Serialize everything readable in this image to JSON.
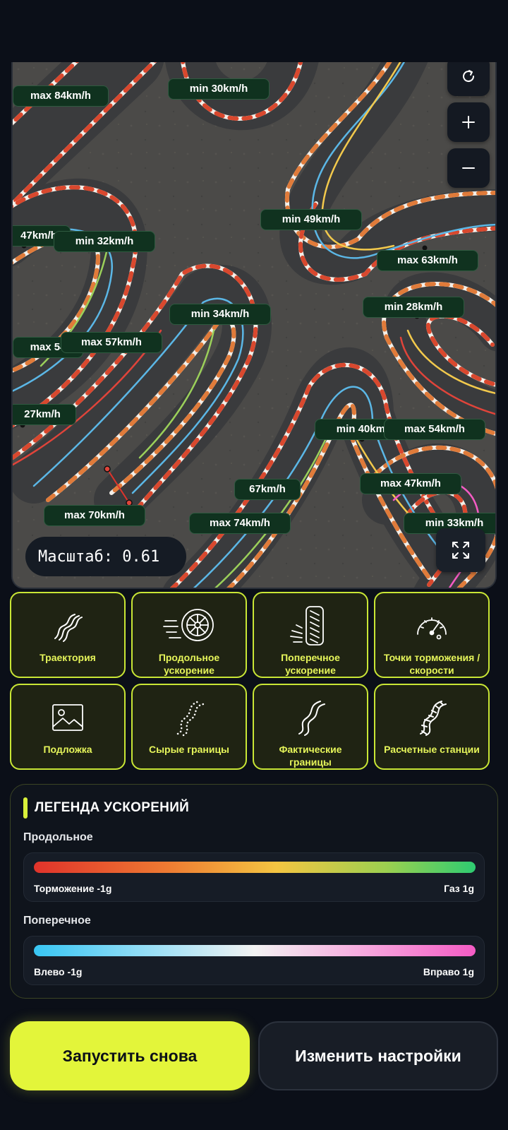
{
  "map": {
    "speed_labels": [
      "max 84km/h",
      "min 30km/h",
      "min 49km/h",
      "47km/h",
      "min 32km/h",
      "max 63km/h",
      "min 28km/h",
      "min 34km/h",
      "max 54",
      "max 57km/h",
      "27km/h",
      "min 40km/h",
      "max 54km/h",
      "max 47km/h",
      "67km/h",
      "max 70km/h",
      "max 74km/h",
      "min 33km/h"
    ],
    "scale_label": "Масштаб: 0.61"
  },
  "controls": {
    "refresh_icon": "refresh-icon",
    "zoom_in_icon": "plus-icon",
    "zoom_out_icon": "minus-icon",
    "fullscreen_icon": "expand-icon"
  },
  "layers": [
    {
      "label": "Траектория",
      "icon": "trajectory-icon"
    },
    {
      "label": "Продольное ускорение",
      "icon": "wheel-icon"
    },
    {
      "label": "Поперечное ускорение",
      "icon": "tire-side-icon"
    },
    {
      "label": "Точки торможения / скорости",
      "icon": "speedometer-icon"
    },
    {
      "label": "Подложка",
      "icon": "image-icon"
    },
    {
      "label": "Сырые границы",
      "icon": "dotted-path-icon"
    },
    {
      "label": "Фактические границы",
      "icon": "path-icon"
    },
    {
      "label": "Расчетные станции",
      "icon": "stations-icon"
    }
  ],
  "legend": {
    "title": "ЛЕГЕНДА УСКОРЕНИЙ",
    "longitudinal": {
      "label": "Продольное",
      "left": "Торможение -1g",
      "right": "Газ 1g"
    },
    "lateral": {
      "label": "Поперечное",
      "left": "Влево -1g",
      "right": "Вправо 1g"
    },
    "colors": {
      "brake": "#e0332b",
      "mid": "#f4c542",
      "gas": "#2ecc71",
      "left": "#38c6f4",
      "center": "#f2f2f2",
      "right": "#f45bc4"
    }
  },
  "actions": {
    "run_again": "Запустить снова",
    "change_settings": "Изменить настройки"
  }
}
